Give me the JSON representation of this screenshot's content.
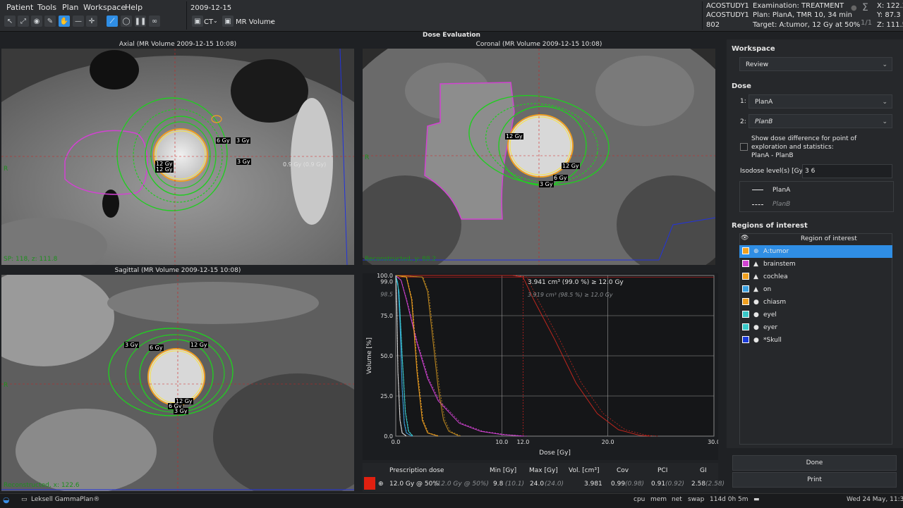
{
  "menu": [
    "Patient",
    "Tools",
    "Plan",
    "Workspace",
    "Help"
  ],
  "toolbar": {
    "date": "2009-12-15",
    "ct_label": "CT",
    "mr_label": "MR Volume"
  },
  "header_info": {
    "study1": "ACOSTUDY1",
    "study2": "ACOSTUDY1",
    "id": "802",
    "examination": "Examination: TREATMENT",
    "plan": "Plan: PlanA, TMR 10, 34 min",
    "target": "Target: A:tumor, 12 Gy at 50%",
    "page": "1/1",
    "x": "X: 122.3",
    "y": "Y: 87.3",
    "z": "Z: 111.5"
  },
  "window_title": "Dose Evaluation",
  "views": {
    "axial": {
      "title": "Axial (MR Volume 2009-12-15 10:08)",
      "coord": "SP: 118, z: 111.8",
      "side": "R"
    },
    "coronal": {
      "title": "Coronal (MR Volume 2009-12-15 10:08)",
      "coord": "Reconstructed, y: 88.2",
      "side": "R"
    },
    "sagittal": {
      "title": "Sagittal (MR Volume 2009-12-15 10:08)",
      "coord": "Reconstructed, x: 122.6",
      "side": "R"
    }
  },
  "dose_labels": {
    "axial": [
      "6 Gy",
      "3 Gy",
      "12 Gy",
      "12 Gy",
      "3 Gy",
      "0.9 Gy (0.9 Gy)"
    ],
    "coronal": [
      "12 Gy",
      "12 Gy",
      "6 Gy",
      "3 Gy"
    ],
    "sagittal": [
      "3 Gy",
      "6 Gy",
      "12 Gy",
      "12 Gy",
      "6 Gy",
      "3 Gy"
    ]
  },
  "chart_data": {
    "type": "line",
    "xlabel": "Dose [Gy]",
    "ylabel": "Volume [%]",
    "xlim": [
      0,
      30
    ],
    "ylim": [
      0,
      100
    ],
    "x_ticks": [
      "0.0",
      "10.0",
      "12.0",
      "20.0",
      "30.0"
    ],
    "y_ticks": [
      "0.0",
      "25.0",
      "50.0",
      "75.0",
      "98.5",
      "99.0",
      "100.0"
    ],
    "annotation_a": "3.941 cm³ (99.0 %) ≥ 12.0 Gy",
    "annotation_b": "3.919 cm³ (98.5 %) ≥ 12.0 Gy",
    "series": [
      {
        "color": "#c0261e",
        "x": [
          0,
          11.0,
          12.0,
          13.0,
          15.0,
          17.0,
          19.0,
          21.0,
          23.0,
          24.0
        ],
        "y": [
          100,
          100,
          99,
          85,
          60,
          33,
          14,
          4,
          0.5,
          0
        ]
      },
      {
        "color": "#d243d2",
        "x": [
          0,
          0.5,
          1.0,
          2.0,
          3.0,
          4.0,
          6.0,
          8.0,
          10.0,
          12.0
        ],
        "y": [
          100,
          97,
          85,
          58,
          36,
          22,
          8,
          3,
          1,
          0
        ]
      },
      {
        "color": "#f0a020",
        "x": [
          0,
          1.0,
          1.5,
          2.0,
          2.5,
          3.0,
          4.0
        ],
        "y": [
          100,
          99,
          85,
          40,
          10,
          2,
          0
        ]
      },
      {
        "color": "#c08a20",
        "x": [
          0,
          2.5,
          3.0,
          3.5,
          4.0,
          4.5,
          5.0,
          6.0
        ],
        "y": [
          100,
          99,
          90,
          60,
          30,
          10,
          3,
          0
        ]
      },
      {
        "color": "#3aa0e0",
        "x": [
          0,
          0.2,
          0.4,
          0.6,
          0.8,
          1.0,
          1.5
        ],
        "y": [
          100,
          95,
          70,
          30,
          8,
          2,
          0
        ]
      },
      {
        "color": "#38c8c8",
        "x": [
          0,
          0.3,
          0.6,
          0.9,
          1.2,
          1.6
        ],
        "y": [
          100,
          90,
          50,
          15,
          3,
          0
        ]
      },
      {
        "color": "#e0e0e0",
        "x": [
          0,
          0.1,
          0.2,
          0.4,
          0.6,
          1.0
        ],
        "y": [
          100,
          80,
          40,
          10,
          2,
          0
        ]
      }
    ]
  },
  "stats": {
    "headers": [
      "Prescription dose",
      "Min [Gy]",
      "Max [Gy]",
      "Vol. [cm³]",
      "Cov",
      "PCI",
      "GI"
    ],
    "row": {
      "prescription": "12.0 Gy @ 50%",
      "prescription_b": "(12.0 Gy @ 50%)",
      "min": "9.8",
      "min_b": "(10.1)",
      "max": "24.0",
      "max_b": "(24.0)",
      "vol": "3.981",
      "cov": "0.99",
      "cov_b": "(0.98)",
      "pci": "0.91",
      "pci_b": "(0.92)",
      "gi": "2.58",
      "gi_b": "(2.58)"
    }
  },
  "panel": {
    "workspace_label": "Workspace",
    "workspace_value": "Review",
    "dose_label": "Dose",
    "dose1_index": "1:",
    "dose1": "PlanA",
    "dose2_index": "2:",
    "dose2": "PlanB",
    "diff_line1": "Show dose difference for point of",
    "diff_line2": "exploration and statistics:",
    "diff_line3": "PlanA - PlanB",
    "isodose_label": "Isodose level(s) [Gy]",
    "isodose_value": "3 6",
    "legend_a": "PlanA",
    "legend_b": "PlanB",
    "roi_label": "Regions of interest",
    "roi_header": "Region of interest",
    "rois": [
      {
        "name": "A:tumor",
        "color": "#f0a020",
        "icon": "⊕"
      },
      {
        "name": "brainstem",
        "color": "#d243d2",
        "icon": "▲"
      },
      {
        "name": "cochlea",
        "color": "#f0a020",
        "icon": "▲"
      },
      {
        "name": "on",
        "color": "#3aa0e0",
        "icon": "▲"
      },
      {
        "name": "chiasm",
        "color": "#f0a020",
        "icon": "●"
      },
      {
        "name": "eyel",
        "color": "#38c8c8",
        "icon": "●"
      },
      {
        "name": "eyer",
        "color": "#38c8c8",
        "icon": "●"
      },
      {
        "name": "*Skull",
        "color": "#1a3ad8",
        "icon": "●"
      }
    ],
    "done": "Done",
    "print": "Print"
  },
  "taskbar": {
    "app": "Leksell GammaPlan®",
    "cpu": "cpu",
    "mem": "mem",
    "net": "net",
    "swap": "swap",
    "uptime": "114d 0h 5m",
    "datetime": "Wed 24 May, 11:39"
  }
}
